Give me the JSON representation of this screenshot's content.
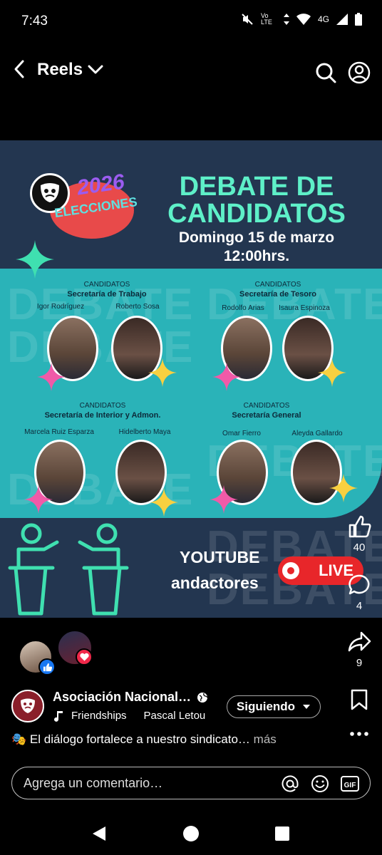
{
  "status_bar": {
    "time": "7:43",
    "network_labels": [
      "Vo LTE",
      "4G"
    ]
  },
  "header": {
    "title": "Reels"
  },
  "poster": {
    "logo_year": "2026",
    "logo_sub": "ELECCIONES",
    "title_line1": "DEBATE DE",
    "title_line2": "CANDIDATOS",
    "date_line1": "Domingo 15 de marzo",
    "date_line2": "12:00hrs.",
    "watermark": "DEBATE",
    "groups": [
      {
        "label": "CANDIDATOS",
        "office": "Secretaría de Trabajo",
        "names": [
          "Igor Rodríguez",
          "Roberto Sosa"
        ]
      },
      {
        "label": "CANDIDATOS",
        "office": "Secretaría de Tesoro",
        "names": [
          "Rodolfo Arias",
          "Isaura Espinoza"
        ]
      },
      {
        "label": "CANDIDATOS",
        "office": "Secretaría de Interior y Admon.",
        "names": [
          "Marcela Ruiz Esparza",
          "Hidelberto Maya"
        ]
      },
      {
        "label": "CANDIDATOS",
        "office": "Secretaría General",
        "names": [
          "Omar Fierro",
          "Aleyda Gallardo"
        ]
      }
    ],
    "youtube_line1": "YOUTUBE",
    "youtube_line2": "andactores",
    "live_label": "LIVE",
    "colors": {
      "background": "#233650",
      "teal": "#2ab3b8",
      "title": "#5ef0c8",
      "live": "#e8262a"
    }
  },
  "rail": {
    "likes": "40",
    "comments": "4",
    "shares": "9"
  },
  "post": {
    "author": "Asociación Nacional…",
    "music": [
      "Friendships",
      "Pascal Letou"
    ],
    "follow_label": "Siguiendo",
    "caption": "El diálogo fortalece a nuestro sindicato…",
    "caption_more": "más"
  },
  "comment_bar": {
    "placeholder": "Agrega un comentario…",
    "gif_label": "GIF"
  }
}
